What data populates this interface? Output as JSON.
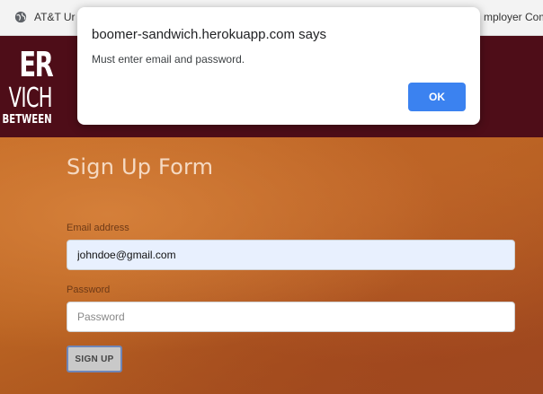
{
  "bookmarks": {
    "left_label": "AT&T Ur",
    "right_label": "mployer Com..."
  },
  "logo": {
    "line1": "ER",
    "line2": "VICH",
    "line3": "BETWEEN"
  },
  "dialog": {
    "title": "boomer-sandwich.herokuapp.com says",
    "message": "Must enter email and password.",
    "ok_label": "OK"
  },
  "form": {
    "title": "Sign Up Form",
    "email_label": "Email address",
    "email_value": "johndoe@gmail.com",
    "password_label": "Password",
    "password_placeholder": "Password",
    "password_value": "",
    "submit_label": "SIGN UP"
  },
  "colors": {
    "header_bg": "#4e0d18",
    "dialog_button": "#3b82f0",
    "autofill_bg": "#e8f0fe"
  }
}
